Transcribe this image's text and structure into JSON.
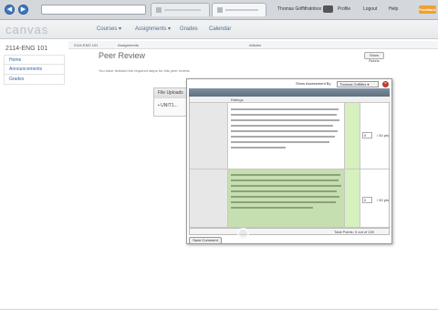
{
  "browser": {
    "tabs": [
      {
        "label": ""
      },
      {
        "label": ""
      }
    ],
    "user_name": "Thomas Griffiths",
    "inbox_label": "Inbox",
    "inbox_count": "",
    "profile_label": "Profile",
    "logout_label": "Logout",
    "help_label": "Help",
    "feedback_label": "Feedback"
  },
  "header": {
    "logo": "canvas",
    "nav": [
      {
        "label": "Courses ▾"
      },
      {
        "label": "Assignments ▾"
      },
      {
        "label": "Grades"
      },
      {
        "label": "Calendar"
      }
    ]
  },
  "sidebar": {
    "course_title": "2114-ENG 101",
    "items": [
      {
        "label": "Home"
      },
      {
        "label": "Announcements"
      },
      {
        "label": "Grades"
      }
    ]
  },
  "breadcrumb": [
    {
      "label": "2114-ENG 101"
    },
    {
      "label": "Assignments"
    },
    {
      "label": "Articles"
    }
  ],
  "main": {
    "title": "Peer Review",
    "unit_line": "",
    "notice": "You have finished the required steps for this peer review.",
    "show_rubric_label": "Show Rubric"
  },
  "file_panel": {
    "header": "File Uploads",
    "file_name": "UNIT1..."
  },
  "rubric": {
    "show_assessment_label": "Show Assessment By",
    "selected_assessor": "Thomas Griffiths",
    "title": "",
    "columns": {
      "criteria": "",
      "ratings": "Ratings",
      "pts": ""
    },
    "criteria": [
      {
        "description": "",
        "sub": "",
        "rating_pts": "",
        "marker": "",
        "points_value": "0",
        "points_total": "/ 50 pts"
      },
      {
        "description": "",
        "sub": "",
        "rating_pts": "",
        "marker": "",
        "points_value": "0",
        "points_total": "/ 50 pts"
      }
    ],
    "total_points": "Total Points: 0 out of 100",
    "save_comment_label": "Save Comment"
  }
}
